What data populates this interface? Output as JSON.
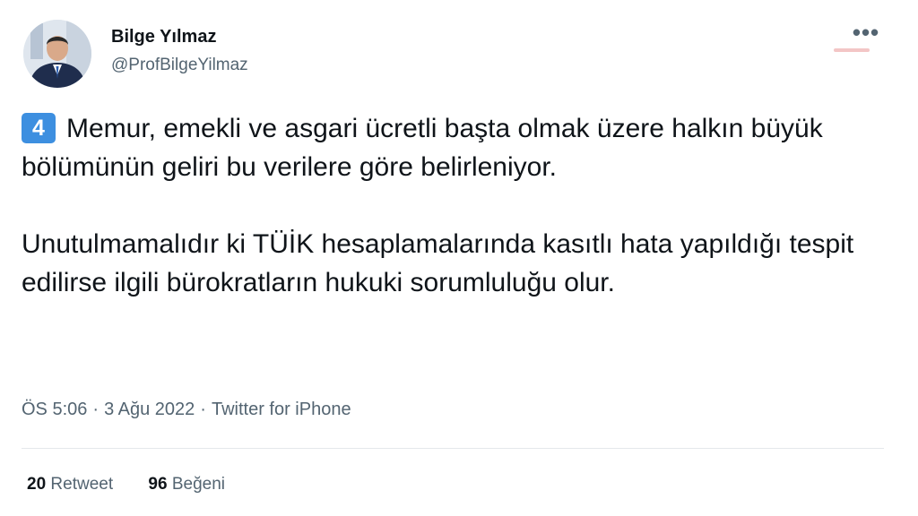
{
  "author": {
    "display_name": "Bilge Yılmaz",
    "handle": "@ProfBilgeYilmaz"
  },
  "more_label": "•••",
  "tweet": {
    "number_emoji": "4",
    "paragraph1": "Memur, emekli ve asgari ücretli başta olmak üzere halkın büyük bölümünün geliri bu verilere göre belirleniyor.",
    "paragraph2": "Unutulmamalıdır ki TÜİK hesaplamalarında kasıtlı hata yapıldığı tespit edilirse ilgili bürokratların hukuki sorumluluğu olur."
  },
  "meta": {
    "time": "ÖS 5:06",
    "date": "3 Ağu 2022",
    "separator": "·",
    "source": "Twitter for iPhone"
  },
  "stats": {
    "retweets_count": "20",
    "retweets_label": "Retweet",
    "likes_count": "96",
    "likes_label": "Beğeni"
  },
  "colors": {
    "text_primary": "#0f1419",
    "text_secondary": "#536471",
    "keycap_blue": "#3d8fe0",
    "divider": "#e4e8eb"
  }
}
